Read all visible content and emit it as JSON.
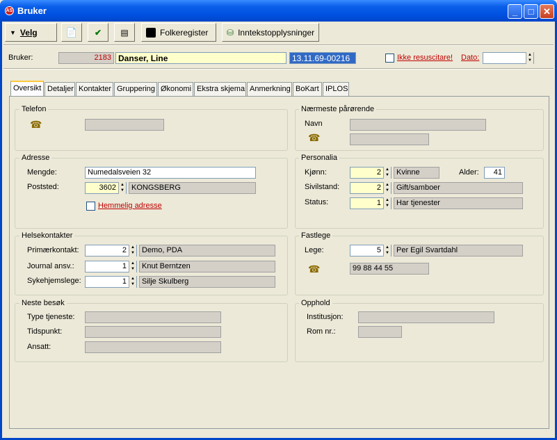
{
  "window": {
    "title": "Bruker",
    "app_icon": "AS"
  },
  "toolbar": {
    "velg": "Velg",
    "folkeregister": "Folkeregister",
    "inntekt": "Inntekstopplysninger"
  },
  "header": {
    "label": "Bruker:",
    "id": "2183",
    "name": "Danser, Line",
    "personnr": "13.11.69-00216",
    "ikke_resus": "Ikke resuscitare!",
    "dato_label": "Dato:",
    "dato_value": ""
  },
  "tabs": [
    "Oversikt",
    "Detaljer",
    "Kontakter",
    "Gruppering",
    "Økonomi",
    "Ekstra skjema",
    "Anmerkning",
    "BoKart",
    "IPLOS"
  ],
  "telefon": {
    "title": "Telefon",
    "value": ""
  },
  "adresse": {
    "title": "Adresse",
    "mengde_label": "Mengde:",
    "mengde": "Numedalsveien 32",
    "poststed_label": "Poststed:",
    "postnr": "3602",
    "poststed": "KONGSBERG",
    "hemmelig": "Hemmelig adresse"
  },
  "helse": {
    "title": "Helsekontakter",
    "primaer_label": "Primærkontakt:",
    "primaer_nr": "2",
    "primaer": "Demo, PDA",
    "journal_label": "Journal ansv.:",
    "journal_nr": "1",
    "journal": "Knut Berntzen",
    "syke_label": "Sykehjemslege:",
    "syke_nr": "1",
    "syke": "Silje Skulberg"
  },
  "besok": {
    "title": "Neste besøk",
    "type_label": "Type tjeneste:",
    "tid_label": "Tidspunkt:",
    "ansatt_label": "Ansatt:"
  },
  "parorende": {
    "title": "Nærmeste pårørende",
    "navn_label": "Navn"
  },
  "personalia": {
    "title": "Personalia",
    "kjonn_label": "Kjønn:",
    "kjonn_nr": "2",
    "kjonn": "Kvinne",
    "alder_label": "Alder:",
    "alder": "41",
    "sivil_label": "Sivilstand:",
    "sivil_nr": "2",
    "sivil": "Gift/samboer",
    "status_label": "Status:",
    "status_nr": "1",
    "status": "Har tjenester"
  },
  "fastlege": {
    "title": "Fastlege",
    "lege_label": "Lege:",
    "lege_nr": "5",
    "lege": "Per Egil Svartdahl",
    "telefon": "99 88 44 55"
  },
  "opphold": {
    "title": "Opphold",
    "inst_label": "Institusjon:",
    "rom_label": "Rom nr.:"
  }
}
